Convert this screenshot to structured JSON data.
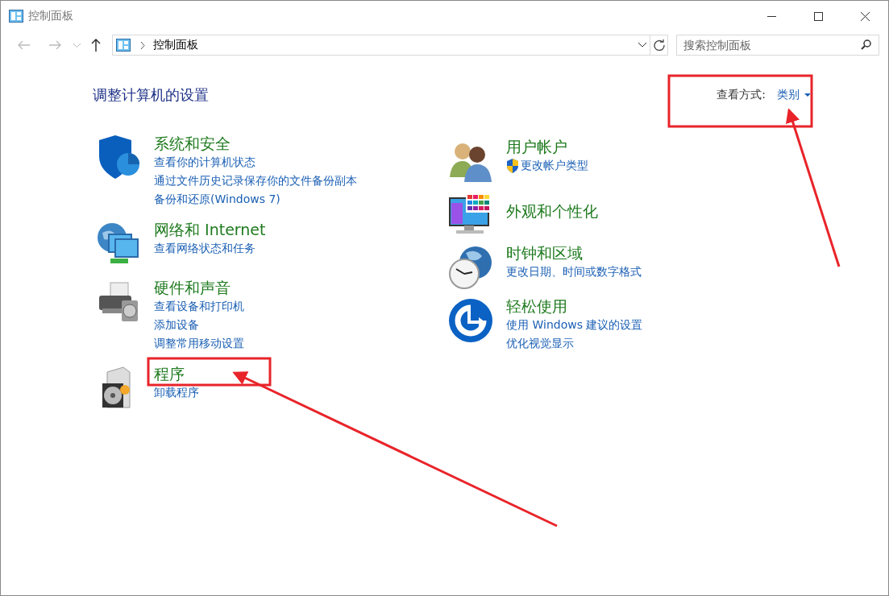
{
  "window": {
    "title": "控制面板"
  },
  "nav": {
    "address": "控制面板",
    "search": {
      "placeholder": "搜索控制面板"
    }
  },
  "heading": "调整计算机的设置",
  "view_by": {
    "label": "查看方式:",
    "value": "类别"
  },
  "left_column": [
    {
      "kind": "security",
      "title": "系统和安全",
      "links": [
        {
          "kind": "plain",
          "text": "查看你的计算机状态"
        },
        {
          "kind": "plain",
          "text": "通过文件历史记录保存你的文件备份副本"
        },
        {
          "kind": "plain",
          "text": "备份和还原(Windows 7)"
        }
      ]
    },
    {
      "kind": "network",
      "title": "网络和 Internet",
      "links": [
        {
          "kind": "plain",
          "text": "查看网络状态和任务"
        }
      ]
    },
    {
      "kind": "hardware",
      "title": "硬件和声音",
      "links": [
        {
          "kind": "plain",
          "text": "查看设备和打印机"
        },
        {
          "kind": "plain",
          "text": "添加设备"
        },
        {
          "kind": "plain",
          "text": "调整常用移动设置"
        }
      ]
    },
    {
      "kind": "programs",
      "title": "程序",
      "links": [
        {
          "kind": "plain",
          "text": "卸载程序"
        }
      ]
    }
  ],
  "right_column": [
    {
      "kind": "users",
      "title": "用户帐户",
      "links": [
        {
          "kind": "shield",
          "text": "更改帐户类型"
        }
      ]
    },
    {
      "kind": "appearance",
      "title": "外观和个性化"
    },
    {
      "kind": "clock",
      "title": "时钟和区域",
      "links": [
        {
          "kind": "plain",
          "text": "更改日期、时间或数字格式"
        }
      ]
    },
    {
      "kind": "ease",
      "title": "轻松使用",
      "links": [
        {
          "kind": "plain",
          "text": "使用 Windows 建议的设置"
        },
        {
          "kind": "plain",
          "text": "优化视觉显示"
        }
      ]
    }
  ]
}
